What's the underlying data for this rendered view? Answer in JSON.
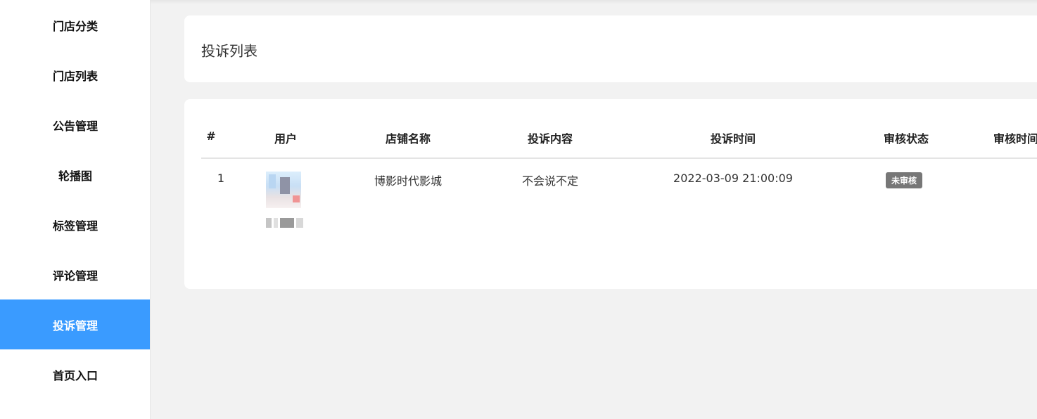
{
  "sidebar": {
    "items": [
      {
        "label": "门店分类",
        "active": false
      },
      {
        "label": "门店列表",
        "active": false
      },
      {
        "label": "公告管理",
        "active": false
      },
      {
        "label": "轮播图",
        "active": false
      },
      {
        "label": "标签管理",
        "active": false
      },
      {
        "label": "评论管理",
        "active": false
      },
      {
        "label": "投诉管理",
        "active": true
      },
      {
        "label": "首页入口",
        "active": false
      }
    ],
    "active_color": "#3a9bff"
  },
  "page": {
    "title": "投诉列表"
  },
  "table": {
    "columns": [
      "#",
      "用户",
      "店铺名称",
      "投诉内容",
      "投诉时间",
      "审核状态",
      "审核时间"
    ],
    "rows": [
      {
        "index": "1",
        "user_avatar": "user-avatar (pixelated)",
        "store_name": "博影时代影城",
        "content": "不会说不定",
        "time": "2022-03-09 21:00:09",
        "status": "未审核",
        "review_time": ""
      }
    ]
  },
  "colors": {
    "badge": "#777777",
    "background": "#f2f2f2"
  }
}
